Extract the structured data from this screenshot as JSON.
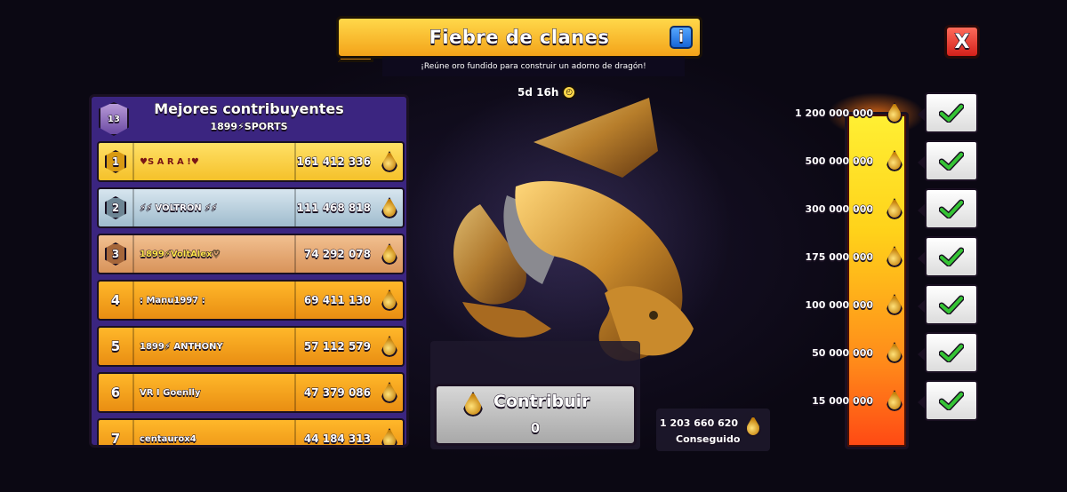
{
  "event": {
    "title": "Fiebre de clanes",
    "subtitle": "¡Reúne oro fundido para construir un adorno de dragón!",
    "timer": "5d 16h",
    "info_label": "i",
    "close_label": "X"
  },
  "leaderboard": {
    "title": "Mejores contribuyentes",
    "clan_name": "1899⚡SPORTS",
    "clan_level": "13",
    "rows": [
      {
        "rank": "1",
        "name": "♥S A R A !♥",
        "value": "161 412 336"
      },
      {
        "rank": "2",
        "name": "⚡⚡ VOLTRON ⚡⚡",
        "value": "111 468 818"
      },
      {
        "rank": "3",
        "name": "1899⚡VoltAlex♡",
        "value": "74 292 078"
      },
      {
        "rank": "4",
        "name": ": Manu1997 :",
        "value": "69 411 130"
      },
      {
        "rank": "5",
        "name": "1899⚡ ANTHONY",
        "value": "57 112 579"
      },
      {
        "rank": "6",
        "name": "VR I Goenlly",
        "value": "47 379 086"
      },
      {
        "rank": "7",
        "name": "centaurox4",
        "value": "44 184 313"
      }
    ]
  },
  "contribute": {
    "label": "Contribuir",
    "amount": "0"
  },
  "achieved": {
    "value": "1 203 660 620",
    "label": "Conseguido"
  },
  "milestones": [
    {
      "value": "1 200 000 000",
      "completed": true
    },
    {
      "value": "500 000 000",
      "completed": true
    },
    {
      "value": "300 000 000",
      "completed": true
    },
    {
      "value": "175 000 000",
      "completed": true
    },
    {
      "value": "100 000 000",
      "completed": true
    },
    {
      "value": "50 000 000",
      "completed": true
    },
    {
      "value": "15 000 000",
      "completed": true
    }
  ],
  "progress": {
    "fraction": 1.0
  },
  "colors": {
    "gold": "#f3a319",
    "panel": "#3b2580",
    "check": "#2fbf2f",
    "close": "#d4201a"
  }
}
